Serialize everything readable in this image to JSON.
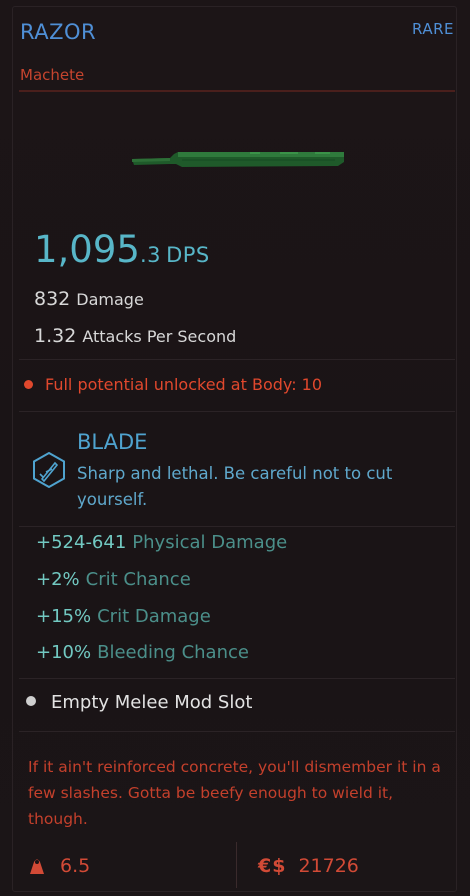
{
  "item": {
    "name": "RAZOR",
    "rarity": "RARE",
    "type": "Machete"
  },
  "dps": {
    "whole": "1,095",
    "decimal": ".3",
    "unit": "DPS"
  },
  "stats": [
    {
      "value": "832",
      "label": "Damage"
    },
    {
      "value": "1.32",
      "label": "Attacks Per Second"
    }
  ],
  "requirement": "Full potential unlocked at Body: 10",
  "mod": {
    "icon": "blade-icon",
    "title": "BLADE",
    "description": "Sharp and lethal. Be careful not to cut yourself."
  },
  "bonuses": [
    {
      "value": "+524-641",
      "label": "Physical Damage"
    },
    {
      "value": "+2%",
      "label": "Crit Chance"
    },
    {
      "value": "+15%",
      "label": "Crit Damage"
    },
    {
      "value": "+10%",
      "label": "Bleeding Chance"
    }
  ],
  "slot": "Empty Melee Mod Slot",
  "lore": "If it ain't reinforced concrete, you'll dismember it in a few slashes. Gotta be beefy enough to wield it, though.",
  "footer": {
    "weight": "6.5",
    "currency_symbol": "€$",
    "price": "21726"
  },
  "colors": {
    "accent_blue": "#4f8fd6",
    "accent_red": "#c5442e",
    "dps_cyan": "#58b6c8",
    "bonus_teal": "#72c9c2",
    "background": "#1a1416"
  }
}
